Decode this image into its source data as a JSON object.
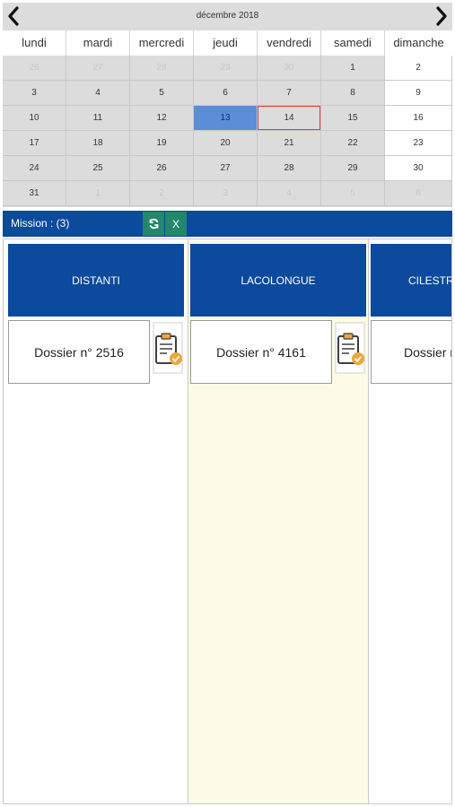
{
  "calendar": {
    "title": "décembre 2018",
    "weekdays": [
      "lundi",
      "mardi",
      "mercredi",
      "jeudi",
      "vendredi",
      "samedi",
      "dimanche"
    ],
    "weeks": [
      [
        "26",
        "27",
        "28",
        "29",
        "30",
        "1",
        "2"
      ],
      [
        "3",
        "4",
        "5",
        "6",
        "7",
        "8",
        "9"
      ],
      [
        "10",
        "11",
        "12",
        "13",
        "14",
        "15",
        "16"
      ],
      [
        "17",
        "18",
        "19",
        "20",
        "21",
        "22",
        "23"
      ],
      [
        "24",
        "25",
        "26",
        "27",
        "28",
        "29",
        "30"
      ],
      [
        "31",
        "1",
        "2",
        "3",
        "4",
        "5",
        "6"
      ]
    ],
    "selected_day": "13",
    "today_day": "14",
    "colors": {
      "selected": "#5b8ed9",
      "today_border": "#e03a3a",
      "header": "#dcdcdc"
    }
  },
  "mission_bar": {
    "label": "Mission : (3)",
    "refresh_icon": "refresh-icon",
    "close_label": "X",
    "colors": {
      "bar": "#0b4a9c",
      "buttons": "#22876b"
    }
  },
  "columns": [
    {
      "title": "DISTANTI",
      "card": "Dossier n° 2516",
      "icon": "clipboard-check-icon"
    },
    {
      "title": "LACOLONGUE",
      "card": "Dossier n° 4161",
      "icon": "clipboard-check-icon"
    },
    {
      "title": "CILESTRIN",
      "card": "Dossier n°",
      "icon": "clipboard-check-icon"
    }
  ],
  "colors": {
    "column_header": "#0b4a9c",
    "highlight_column": "#fdfbe6"
  }
}
